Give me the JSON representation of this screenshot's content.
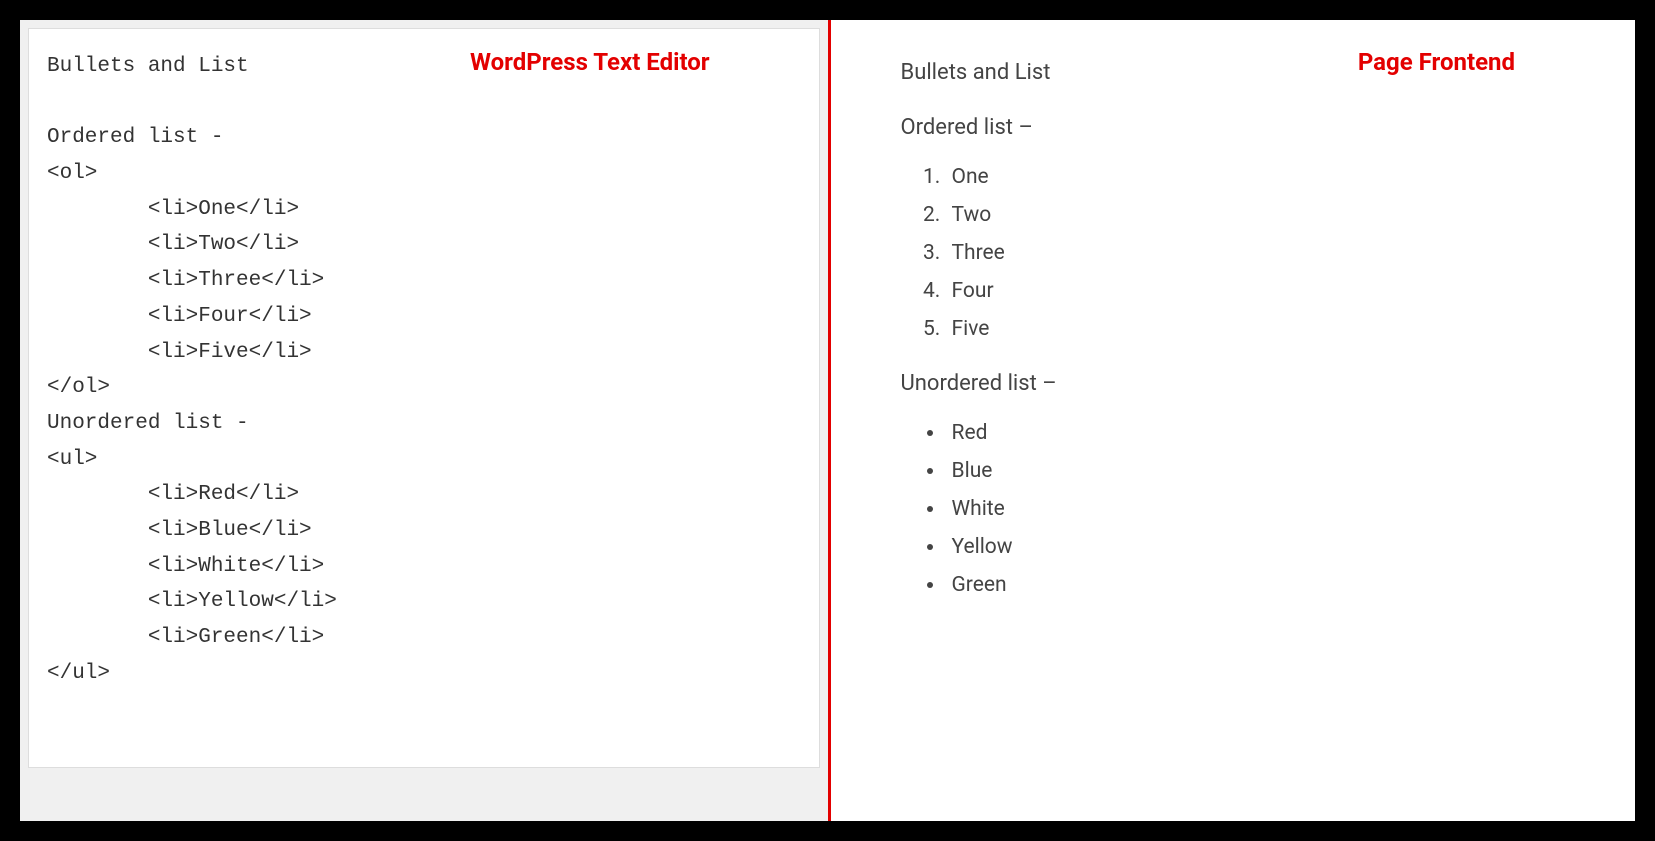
{
  "leftLabel": "WordPress Text Editor",
  "rightLabel": "Page Frontend",
  "editor": {
    "raw": "Bullets and List\n\nOrdered list -\n<ol>\n        <li>One</li>\n        <li>Two</li>\n        <li>Three</li>\n        <li>Four</li>\n        <li>Five</li>\n</ol>\nUnordered list -\n<ul>\n        <li>Red</li>\n        <li>Blue</li>\n        <li>White</li>\n        <li>Yellow</li>\n        <li>Green</li>\n</ul>"
  },
  "frontend": {
    "title": "Bullets and List",
    "orderedLabel": "Ordered list –",
    "ordered": [
      "One",
      "Two",
      "Three",
      "Four",
      "Five"
    ],
    "unorderedLabel": "Unordered list –",
    "unordered": [
      "Red",
      "Blue",
      "White",
      "Yellow",
      "Green"
    ]
  }
}
